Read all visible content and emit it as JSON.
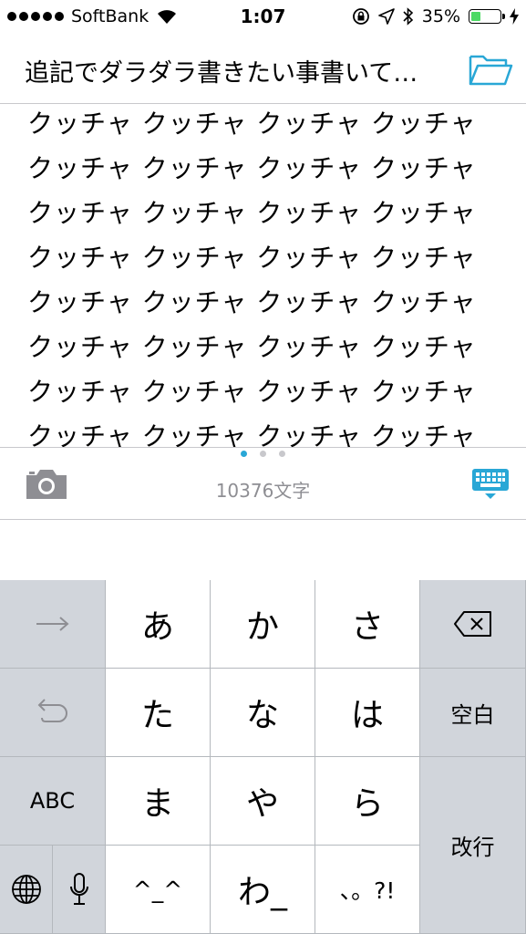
{
  "status_bar": {
    "carrier": "SoftBank",
    "time": "1:07",
    "battery_percent": "35%",
    "battery_level": 0.35,
    "accent": "#4cd964"
  },
  "header": {
    "title": "追記でダラダラ書きたい事書いて…",
    "folder_icon": "folder-icon",
    "icon_color": "#29a7d6"
  },
  "editor": {
    "lines": [
      "クッチャ クッチャ クッチャ クッチャ",
      "クッチャ クッチャ クッチャ クッチャ",
      "クッチャ クッチャ クッチャ クッチャ",
      "クッチャ クッチャ クッチャ クッチャ",
      "クッチャ クッチャ クッチャ クッチャ",
      "クッチャ クッチャ クッチャ クッチャ",
      "クッチャ クッチャ クッチャ クッチャ",
      "クッチャ クッチャ クッチャ クッチャ"
    ]
  },
  "footer": {
    "char_count": "10376文字",
    "page_count": 3,
    "active_page": 1
  },
  "keyboard": {
    "row1": [
      "あ",
      "か",
      "さ"
    ],
    "row2": [
      "た",
      "な",
      "は"
    ],
    "row3": [
      "ま",
      "や",
      "ら"
    ],
    "row4": [
      "^_^",
      "わ_",
      "、。?!"
    ],
    "abc": "ABC",
    "space": "空白",
    "return": "改行"
  }
}
